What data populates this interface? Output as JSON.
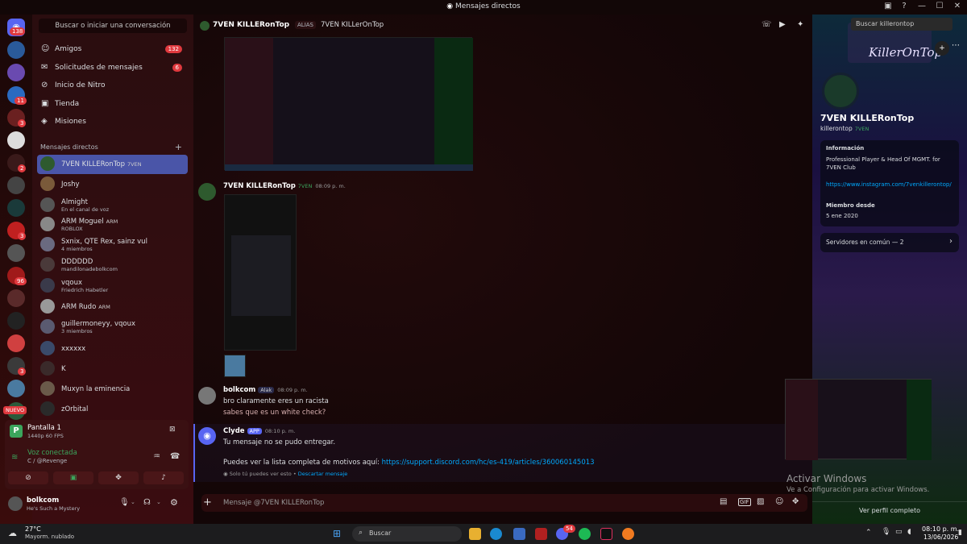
{
  "window": {
    "title": "Mensajes directos"
  },
  "servers": {
    "home_badge": "138",
    "badges": [
      "11",
      "3",
      "2",
      "3",
      "96",
      "3"
    ],
    "new_label": "NUEVO"
  },
  "sidebar": {
    "search_placeholder": "Buscar o iniciar una conversación",
    "nav": [
      {
        "label": "Amigos",
        "count": "132",
        "icon": "friends-icon"
      },
      {
        "label": "Solicitudes de mensajes",
        "count": "6",
        "icon": "mail-icon"
      },
      {
        "label": "Inicio de Nitro",
        "count": "",
        "icon": "nitro-icon"
      },
      {
        "label": "Tienda",
        "count": "",
        "icon": "shop-icon"
      },
      {
        "label": "Misiones",
        "count": "",
        "icon": "quest-icon"
      }
    ],
    "dm_header": "Mensajes directos",
    "dms": [
      {
        "name": "7VEN KILLERonTop",
        "tag": "7VEN",
        "sub": "",
        "color": "#2e5a2e"
      },
      {
        "name": "Joshy",
        "tag": "",
        "sub": "",
        "color": "#7a5a3a"
      },
      {
        "name": "Almight",
        "tag": "",
        "sub": "En el canal de voz",
        "color": "#555"
      },
      {
        "name": "ARM Moguel",
        "tag": "ARM",
        "sub": "ROBLOX",
        "color": "#888"
      },
      {
        "name": "Sxnix, QTE Rex, sainz vul",
        "tag": "",
        "sub": "4 miembros",
        "color": "#6a6a80"
      },
      {
        "name": "DDDDDD",
        "tag": "",
        "sub": "mandilonadebolkcom",
        "color": "#4a3a3a"
      },
      {
        "name": "vqoux",
        "tag": "",
        "sub": "Friedrich Habetler",
        "color": "#3a3a4a"
      },
      {
        "name": "ARM Rudo",
        "tag": "ARM",
        "sub": "",
        "color": "#999"
      },
      {
        "name": "guillermoneyy, vqoux",
        "tag": "",
        "sub": "3 miembros",
        "color": "#5a5a70"
      },
      {
        "name": "xxxxxx",
        "tag": "",
        "sub": "",
        "color": "#3a4a6a"
      },
      {
        "name": "K",
        "tag": "",
        "sub": "",
        "color": "#3a2a2a"
      },
      {
        "name": "Muxyn la eminencia",
        "tag": "",
        "sub": "",
        "color": "#6a5a4a"
      },
      {
        "name": "zOrbital",
        "tag": "",
        "sub": "",
        "color": "#2a2a2a"
      }
    ]
  },
  "voice": {
    "screen": "Pantalla 1",
    "quality": "1440p 60 FPS",
    "status": "Voz conectada",
    "channel": "C / @Revenge"
  },
  "user": {
    "name": "bolkcom",
    "status": "He's Such a Mystery"
  },
  "chat": {
    "header_name": "7VEN KILLERonTop",
    "alias_label": "ALIAS",
    "alias": "7VEN KILLerOnTop",
    "search_placeholder": "Buscar killerontop",
    "messages": [
      {
        "author": "7VEN KILLERonTop",
        "tag": "7VEN",
        "time": "08:09 p. m."
      },
      {
        "author": "bolkcom",
        "tag": "Alak",
        "time": "08:09 p. m.",
        "lines": [
          "bro claramente eres un racista",
          "sabes que es un white check?"
        ]
      },
      {
        "author": "Clyde",
        "tag": "APP",
        "time": "08:10 p. m.",
        "lines": [
          "Tu mensaje no se pudo entregar.",
          "Puedes ver la lista completa de motivos aquí:"
        ],
        "link": "https://support.discord.com/hc/es-419/articles/360060145013",
        "note": "Solo tú puedes ver esto",
        "dismiss": "Descartar mensaje"
      }
    ],
    "input_placeholder": "Mensaje @7VEN KILLERonTop"
  },
  "profile": {
    "display_name": "7VEN KILLERonTop",
    "username": "killerontop",
    "tag": "7VEN",
    "banner_text": "KillerOnTop",
    "info_label": "Información",
    "bio": "Professional Player & Head Of MGMT. for 7VEN Club",
    "link": "https://www.instagram.com/7venkillerontop/",
    "member_label": "Miembro desde",
    "member_since": "5 ene 2020",
    "servers_common": "Servidores en común — 2",
    "view_full": "Ver perfil completo"
  },
  "activate": {
    "title": "Activar Windows",
    "sub": "Ve a Configuración para activar Windows."
  },
  "taskbar": {
    "temp": "27°C",
    "weather": "Mayorm. nublado",
    "search": "Buscar",
    "time": "08:10 p. m.",
    "date": "13/06/2026",
    "discord_badge": "54"
  },
  "colors": {
    "accent": "#5865f2",
    "danger": "#e0393e",
    "selected": "#4a55a8"
  }
}
